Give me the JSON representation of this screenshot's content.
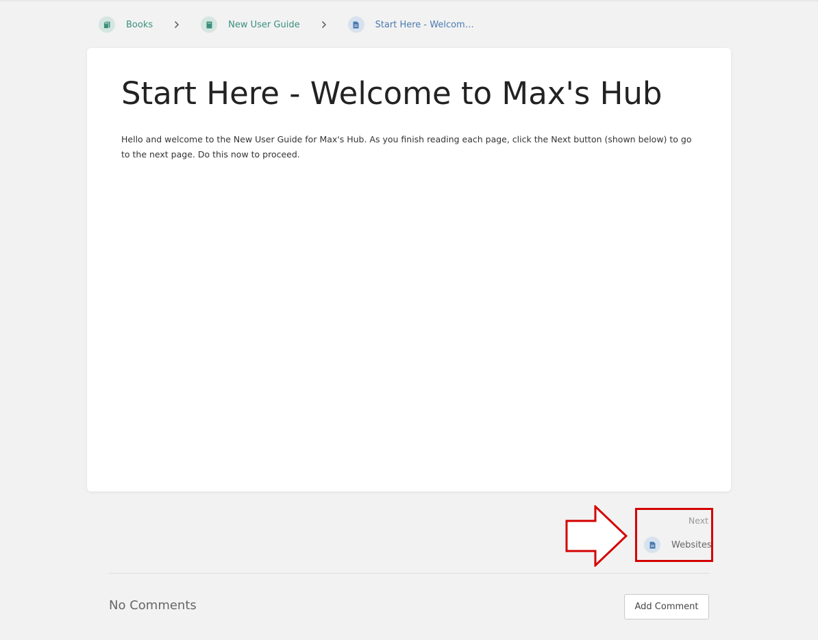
{
  "breadcrumb": {
    "items": [
      {
        "label": "Books",
        "icon": "books-icon"
      },
      {
        "label": "New User Guide",
        "icon": "book-icon"
      },
      {
        "label": "Start Here - Welcome t...",
        "icon": "page-icon"
      }
    ],
    "separator_icon": "chevron-right-icon"
  },
  "page": {
    "title": "Start Here - Welcome to Max's Hub",
    "body": "Hello and welcome to the New User Guide for Max's Hub. As you finish reading each page, click the Next button (shown below) to go to the next page. Do this now to proceed."
  },
  "navigation": {
    "next_label": "Next",
    "next_page": {
      "label": "Websites",
      "icon": "page-icon"
    }
  },
  "annotation": {
    "color": "#d40000"
  },
  "comments": {
    "title": "No Comments",
    "add_button_label": "Add Comment"
  },
  "colors": {
    "background": "#f2f2f2",
    "card": "#ffffff",
    "book_link": "#3a8f7b",
    "page_link": "#4a7bb0"
  }
}
